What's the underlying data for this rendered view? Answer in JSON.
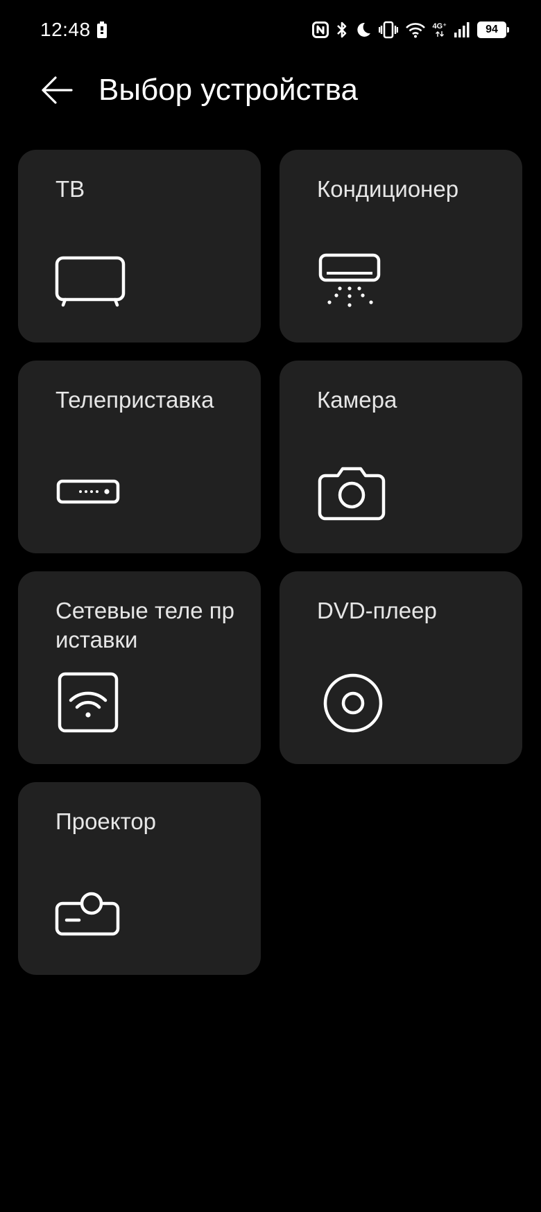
{
  "status_bar": {
    "time": "12:48",
    "network": "4G⁺",
    "battery": "94",
    "icons": [
      "battery-saver-icon",
      "nfc-icon",
      "bluetooth-icon",
      "moon-icon",
      "vibrate-icon",
      "wifi-icon",
      "signal-icon",
      "battery-icon"
    ]
  },
  "header": {
    "title": "Выбор устройства",
    "back_icon": "arrow-left-icon"
  },
  "devices": [
    {
      "label": "ТВ",
      "icon": "tv-icon"
    },
    {
      "label": "Кондиционер",
      "icon": "air-conditioner-icon"
    },
    {
      "label": "Телеприставка",
      "icon": "set-top-box-icon"
    },
    {
      "label": "Камера",
      "icon": "camera-icon"
    },
    {
      "label": "Сетевые теле приставки",
      "icon": "network-box-icon"
    },
    {
      "label": "DVD-плеер",
      "icon": "disc-icon"
    },
    {
      "label": "Проектор",
      "icon": "projector-icon"
    }
  ],
  "colors": {
    "background": "#000000",
    "card": "#212121",
    "text": "#e6e6e6"
  }
}
